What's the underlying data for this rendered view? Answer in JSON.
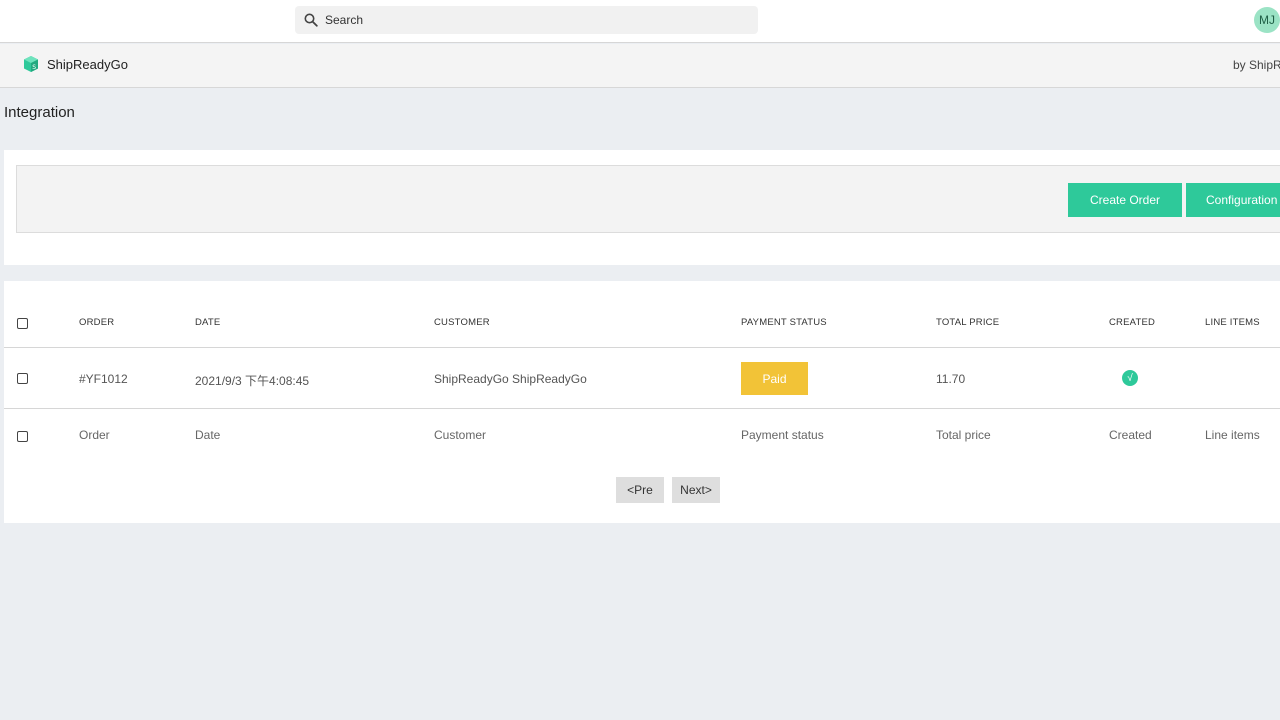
{
  "topbar": {
    "search_placeholder": "Search",
    "avatar_initials": "MJ"
  },
  "app_header": {
    "app_name": "ShipReadyGo",
    "by_text": "by ShipRe"
  },
  "page": {
    "title": "Integration"
  },
  "actions": {
    "create_order_label": "Create Order",
    "configuration_label": "Configuration"
  },
  "table": {
    "headers": {
      "order": "ORDER",
      "date": "DATE",
      "customer": "CUSTOMER",
      "payment_status": "PAYMENT STATUS",
      "total_price": "TOTAL PRICE",
      "created": "CREATED",
      "line_items": "LINE ITEMS"
    },
    "rows": [
      {
        "order": "#YF1012",
        "date": "2021/9/3 下午4:08:45",
        "customer": "ShipReadyGo ShipReadyGo",
        "payment_status": "Paid",
        "total_price": "11.70",
        "created_glyph": "√",
        "line_items": ""
      }
    ],
    "footer": {
      "order": "Order",
      "date": "Date",
      "customer": "Customer",
      "payment_status": "Payment status",
      "total_price": "Total price",
      "created": "Created",
      "line_items": "Line items"
    }
  },
  "pagination": {
    "prev_label": "<Pre",
    "next_label": "Next>"
  },
  "colors": {
    "accent_green": "#2ec99a",
    "paid_yellow": "#f2c337",
    "page_background": "#ebeef2"
  }
}
